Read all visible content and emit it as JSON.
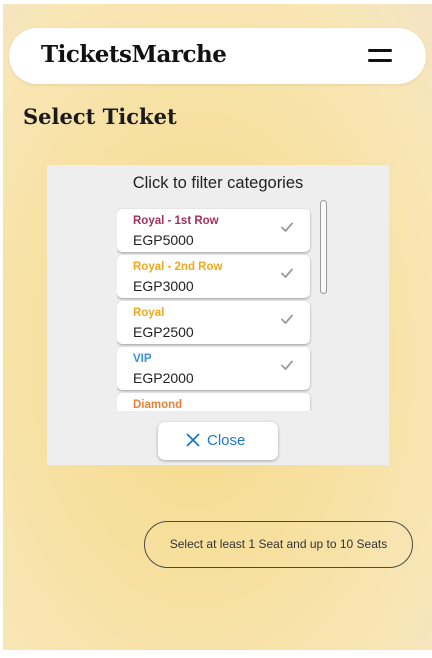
{
  "header": {
    "brand": "TicketsMarche",
    "menu_icon": "hamburger-menu-icon"
  },
  "page": {
    "title": "Select Ticket"
  },
  "filter_modal": {
    "title": "Click to filter categories",
    "categories": [
      {
        "name": "Royal - 1st Row",
        "price": "EGP5000",
        "color": "#a2325a",
        "selected": true
      },
      {
        "name": "Royal - 2nd Row",
        "price": "EGP3000",
        "color": "#f0a81e",
        "selected": true
      },
      {
        "name": "Royal",
        "price": "EGP2500",
        "color": "#f0a81e",
        "selected": true
      },
      {
        "name": "VIP",
        "price": "EGP2000",
        "color": "#3b8fe0",
        "selected": true
      },
      {
        "name": "Diamond",
        "price": "",
        "color": "#e8803a",
        "selected": true
      }
    ],
    "check_icon": "checkmark-icon",
    "close_label": "Close",
    "close_icon": "close-icon",
    "accent": "#1f76c6"
  },
  "seat_hint": "Select at least 1 Seat and up to 10 Seats"
}
